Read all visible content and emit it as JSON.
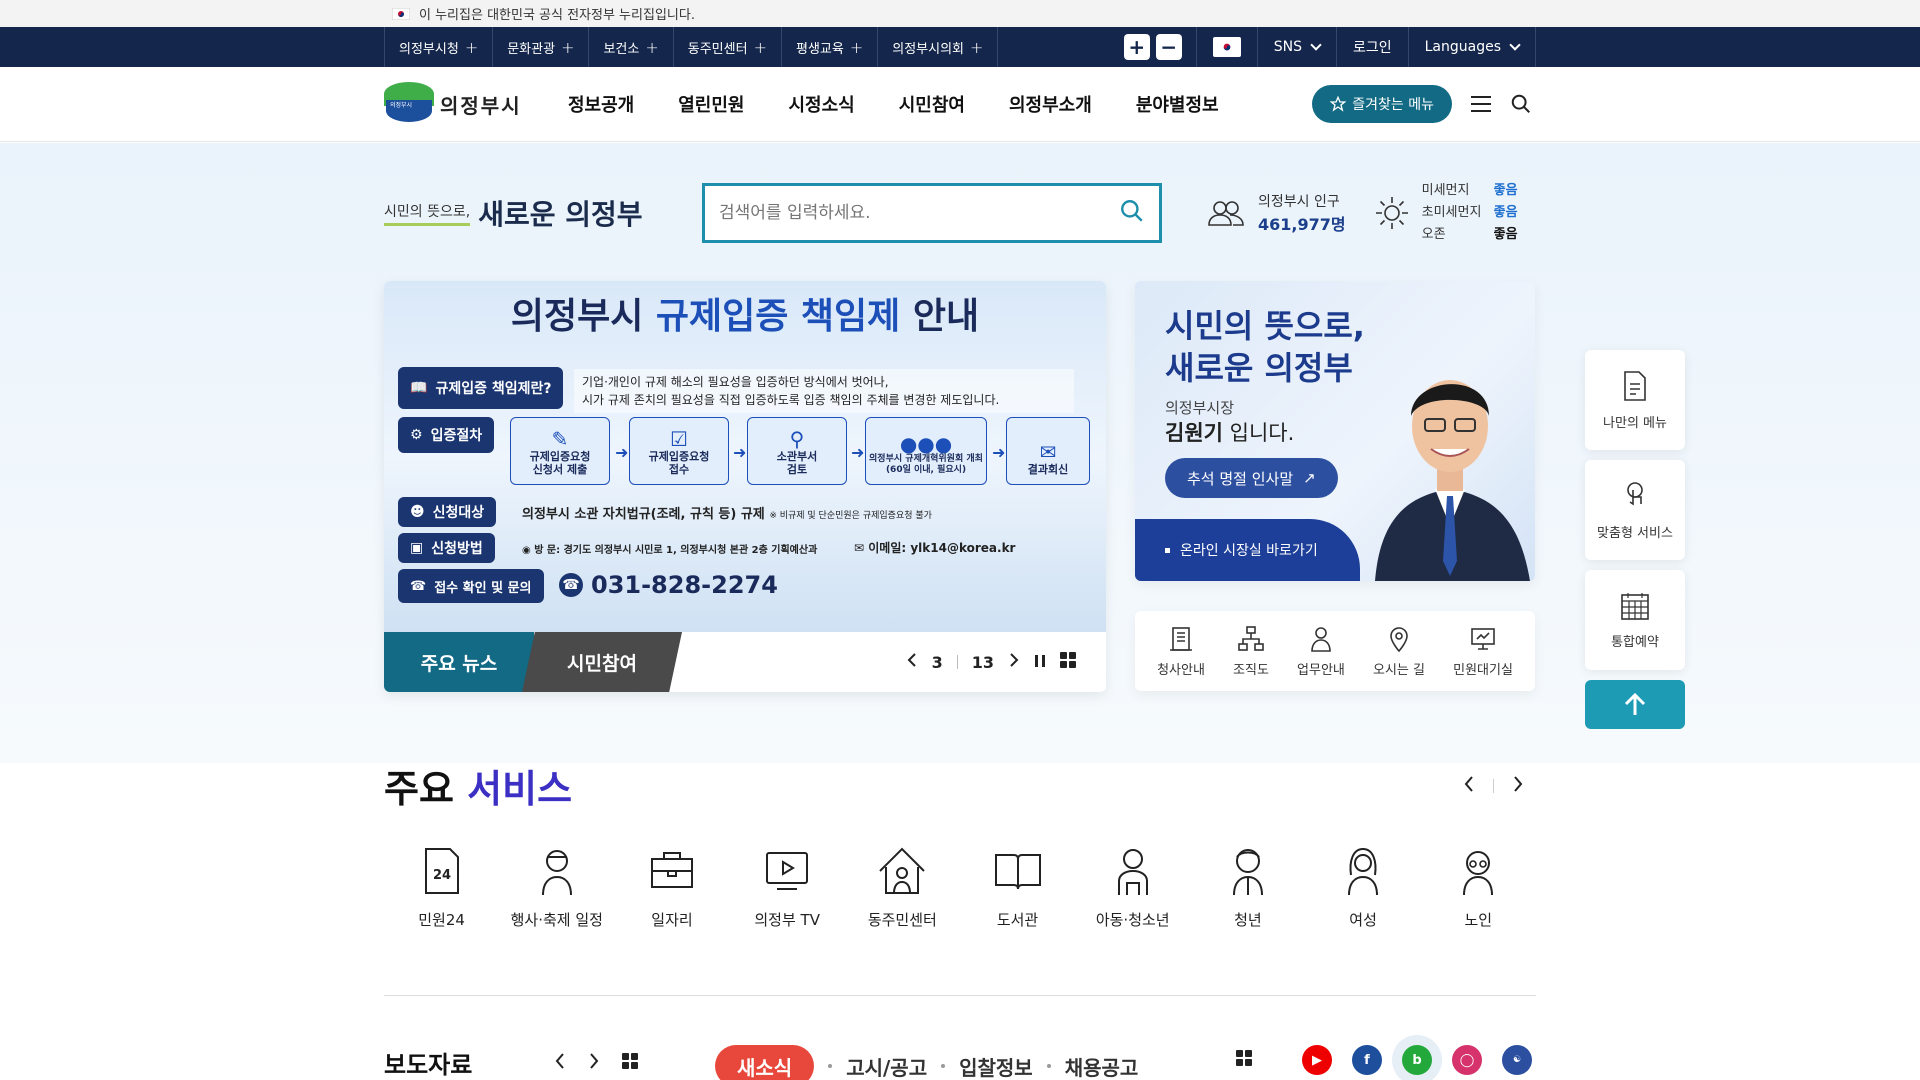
{
  "gov_banner": {
    "text": "이 누리집은 대한민국 공식 전자정부 누리집입니다."
  },
  "site_links": [
    "의정부시청",
    "문화관광",
    "보건소",
    "동주민센터",
    "평생교육",
    "의정부시의회"
  ],
  "site_right": {
    "sns": "SNS",
    "login": "로그인",
    "languages": "Languages"
  },
  "header": {
    "logo_text": "의정부시",
    "logo_badge": "의정부시",
    "gnb": [
      "정보공개",
      "열린민원",
      "시정소식",
      "시민참여",
      "의정부소개",
      "분야별정보"
    ],
    "fav_label": "즐겨찾는 메뉴"
  },
  "hero": {
    "slogan_small": "시민의 뜻으로,",
    "slogan_big": "새로운 의정부",
    "search_placeholder": "검색어를 입력하세요.",
    "population_label": "의정부시 인구",
    "population_value": "461,977명",
    "air": [
      {
        "label": "미세먼지",
        "value": "좋음"
      },
      {
        "label": "초미세먼지",
        "value": "좋음"
      },
      {
        "label": "오존",
        "value": "좋음"
      }
    ]
  },
  "main_banner": {
    "title_a": "의정부시 ",
    "title_b": "규제입증 책임제",
    "title_c": " 안내",
    "what_tag": "규제입증 책임제란?",
    "what_desc_1": "기업·개인이 규제 해소의 필요성을 입증하던 방식에서 벗어나,",
    "what_desc_2": "시가 규제 존치의 필요성을 직접 입증하도록 입증 책임의 주체를 변경한 제도입니다.",
    "proc_tag": "입증절차",
    "steps": [
      {
        "l1": "규제입증요청",
        "l2": "신청서 제출"
      },
      {
        "l1": "규제입증요청",
        "l2": "접수"
      },
      {
        "l1": "소관부서",
        "l2": "검토"
      },
      {
        "l1": "의정부시 규제개혁위원회 개최",
        "l2": "(60일 이내, 필요시)"
      },
      {
        "l1": "결과회신",
        "l2": ""
      }
    ],
    "target_tag": "신청대상",
    "target_text": "의정부시 소관 자치법규(조례, 규칙 등) 규제",
    "target_note": "※ 비규제 및 단순민원은 규제입증요청 불가",
    "method_tag": "신청방법",
    "method_visit": "방    문: 경기도 의정부시 시민로 1, 의정부시청 본관 2층 기획예산과",
    "method_email": "이메일: ylk14@korea.kr",
    "contact_tag": "접수 확인 및 문의",
    "phone": "031-828-2274",
    "tab_news": "주요 뉴스",
    "tab_civic": "시민참여",
    "page_current": "3",
    "page_total": "13"
  },
  "mayor": {
    "slogan_1": "시민의 뜻으로,",
    "slogan_2": "새로운 의정부",
    "role": "의정부시장",
    "name": "김원기",
    "name_suffix": " 입니다.",
    "greeting_btn": "추석 명절 인사말",
    "online_link": "온라인 시장실 바로가기"
  },
  "quick_links": [
    "청사안내",
    "조직도",
    "업무안내",
    "오시는 길",
    "민원대기실"
  ],
  "side_menu": [
    "나만의 메뉴",
    "맞춤형 서비스",
    "통합예약"
  ],
  "services": {
    "title_a": "주요 ",
    "title_b": "서비스",
    "items": [
      "민원24",
      "행사·축제 일정",
      "일자리",
      "의정부 TV",
      "동주민센터",
      "도서관",
      "아동·청소년",
      "청년",
      "여성",
      "노인"
    ]
  },
  "bottom": {
    "press_title": "보도자료",
    "news_tabs": [
      "새소식",
      "고시/공고",
      "입찰정보",
      "채용공고"
    ]
  },
  "colors": {
    "navy": "#14264b",
    "teal": "#126a84",
    "accent_blue": "#1c4fb8",
    "red": "#e8483c"
  }
}
